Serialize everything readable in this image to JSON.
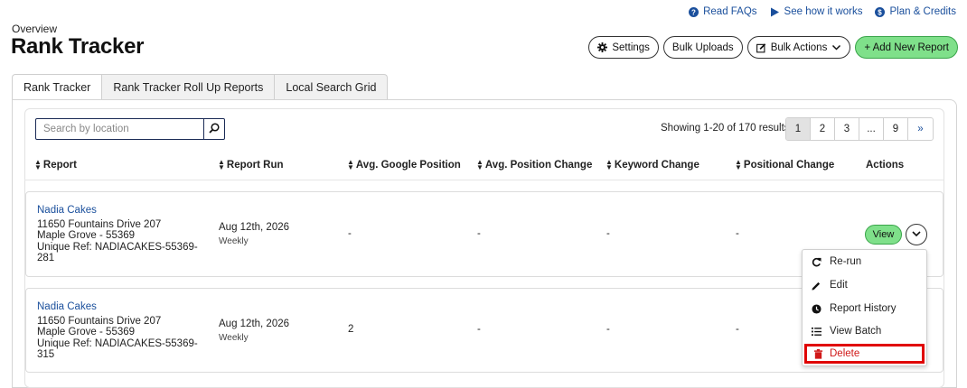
{
  "top_links": [
    {
      "label": "Read FAQs",
      "icon": "question-circle-icon"
    },
    {
      "label": "See how it works",
      "icon": "play-icon"
    },
    {
      "label": "Plan & Credits",
      "icon": "dollar-circle-icon"
    }
  ],
  "header": {
    "overview": "Overview",
    "title": "Rank Tracker"
  },
  "toolbar": {
    "settings": "Settings",
    "bulk_uploads": "Bulk Uploads",
    "bulk_actions": "Bulk Actions",
    "add_new_report": "+ Add New Report"
  },
  "tabs": [
    "Rank Tracker",
    "Rank Tracker Roll Up Reports",
    "Local Search Grid"
  ],
  "search": {
    "placeholder": "Search by location"
  },
  "results_text": "Showing 1-20 of 170 results",
  "pagination": [
    "1",
    "2",
    "3",
    "...",
    "9",
    "»"
  ],
  "columns": [
    "Report",
    "Report Run",
    "Avg. Google Position",
    "Avg. Position Change",
    "Keyword Change",
    "Positional Change",
    "Actions"
  ],
  "rows": [
    {
      "name": "Nadia Cakes",
      "address1": "11650 Fountains Drive 207",
      "address2": "Maple Grove - 55369",
      "ref1": "Unique Ref: NADIACAKES-55369-",
      "ref2": "281",
      "run_date": "Aug 12th, 2026",
      "frequency": "Weekly",
      "avg_position": "-",
      "avg_change": "-",
      "keyword_change": "-",
      "positional_change": "-"
    },
    {
      "name": "Nadia Cakes",
      "address1": "11650 Fountains Drive 207",
      "address2": "Maple Grove - 55369",
      "ref1": "Unique Ref: NADIACAKES-55369-",
      "ref2": "315",
      "run_date": "Aug 12th, 2026",
      "frequency": "Weekly",
      "avg_position": "2",
      "avg_change": "-",
      "keyword_change": "-",
      "positional_change": "-"
    }
  ],
  "actions": {
    "view": "View"
  },
  "dropdown_menu": [
    {
      "label": "Re-run",
      "icon": "refresh-icon"
    },
    {
      "label": "Edit",
      "icon": "pencil-icon"
    },
    {
      "label": "Report History",
      "icon": "clock-icon"
    },
    {
      "label": "View Batch",
      "icon": "list-icon"
    },
    {
      "label": "Delete",
      "icon": "trash-icon"
    }
  ],
  "colors": {
    "link": "#1a4f9c",
    "green": "#7fe08a",
    "delete_highlight": "#e00000"
  }
}
